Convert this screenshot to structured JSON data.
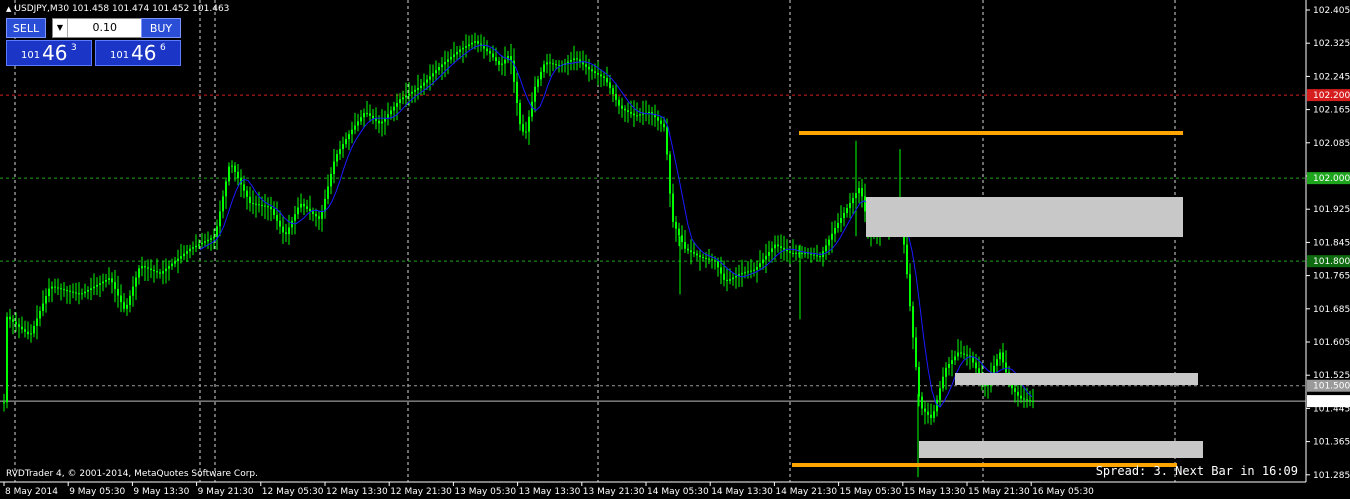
{
  "window": {
    "title": "USDJPY,M30  101.458 101.474 101.452 101.463",
    "copyright": "RVDTrader 4, © 2001-2014, MetaQuotes Software Corp.",
    "status": "Spread: 3.  Next Bar in 16:09"
  },
  "trade_panel": {
    "sell_label": "SELL",
    "buy_label": "BUY",
    "lot_value": "0.10",
    "sell_price": {
      "prefix": "101",
      "big": "46",
      "sup": "3"
    },
    "buy_price": {
      "prefix": "101",
      "big": "46",
      "sup": "6"
    }
  },
  "colors": {
    "candle": "#00ff00",
    "ma": "#1a1aff",
    "red_level": "#d61e1e",
    "green_level": "#1ea51e",
    "orange_line": "#ffa500",
    "zone": "#c8c8c8",
    "grid": "#ffffff"
  },
  "axis": {
    "price_labels": [
      "102.405",
      "102.325",
      "102.245",
      "102.165",
      "102.085",
      "102.005",
      "101.925",
      "101.845",
      "101.765",
      "101.685",
      "101.605",
      "101.525",
      "101.445",
      "101.365",
      "101.285"
    ],
    "time_labels": [
      "8 May 2014",
      "9 May 05:30",
      "9 May 13:30",
      "9 May 21:30",
      "12 May 05:30",
      "12 May 13:30",
      "12 May 21:30",
      "13 May 05:30",
      "13 May 13:30",
      "13 May 21:30",
      "14 May 05:30",
      "14 May 13:30",
      "14 May 21:30",
      "15 May 05:30",
      "15 May 13:30",
      "15 May 21:30",
      "16 May 05:30"
    ],
    "level_labels": {
      "red": "102.200",
      "green1": "102.000",
      "green2": "101.800",
      "gray": "101.500",
      "current": "101.463"
    }
  }
}
